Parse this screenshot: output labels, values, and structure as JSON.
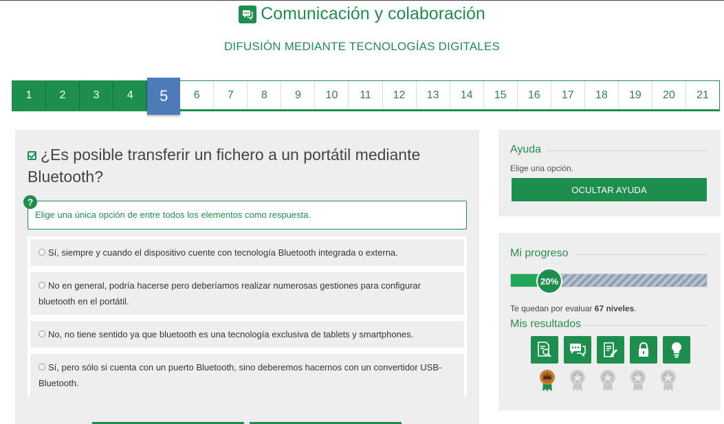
{
  "header": {
    "title": "Comunicación y colaboración",
    "subtitle": "DIFUSIÓN MEDIANTE TECNOLOGÍAS DIGITALES"
  },
  "levels": {
    "items": [
      "1",
      "2",
      "3",
      "4",
      "5",
      "6",
      "7",
      "8",
      "9",
      "10",
      "11",
      "12",
      "13",
      "14",
      "15",
      "16",
      "17",
      "18",
      "19",
      "20",
      "21"
    ],
    "completed": [
      "1",
      "2",
      "3",
      "4"
    ],
    "current": "5"
  },
  "question": {
    "text": "¿Es posible transferir un fichero a un portátil mediante Bluetooth?",
    "hint": "Elige una única opción de entre todos los elementos como respuesta.",
    "options": [
      "Sí, siempre y cuando el dispositivo cuente con tecnología Bluetooth integrada o externa.",
      "No en general, podría hacerse pero deberíamos realizar numerosas gestiones para configurar bluetooth en el portátil.",
      "No, no tiene sentido ya que bluetooth es una tecnología exclusiva de tablets y smartphones.",
      "Sí, pero sólo si cuenta con un puerto Bluetooth, sino deberemos hacernos con un convertidor USB-Bluetooth."
    ]
  },
  "help": {
    "title": "Ayuda",
    "text": "Elige una opción.",
    "button": "OCULTAR AYUDA"
  },
  "progress": {
    "title": "Mi progreso",
    "percent_label": "20%",
    "fraction": 0.2,
    "remaining_prefix": "Te quedan por evaluar",
    "remaining_value": "67 niveles",
    "remaining_suffix": "."
  },
  "results": {
    "title": "Mis resultados",
    "icons": [
      "document-search-icon",
      "chat-bubbles-icon",
      "edit-document-icon",
      "lock-icon",
      "lightbulb-icon"
    ],
    "medals": [
      "bronze",
      "grey",
      "grey",
      "grey",
      "grey"
    ]
  },
  "colors": {
    "brand_green": "#1e8e4e",
    "current_level_blue": "#4c7bb7",
    "panel_gray": "#eeeeee"
  }
}
